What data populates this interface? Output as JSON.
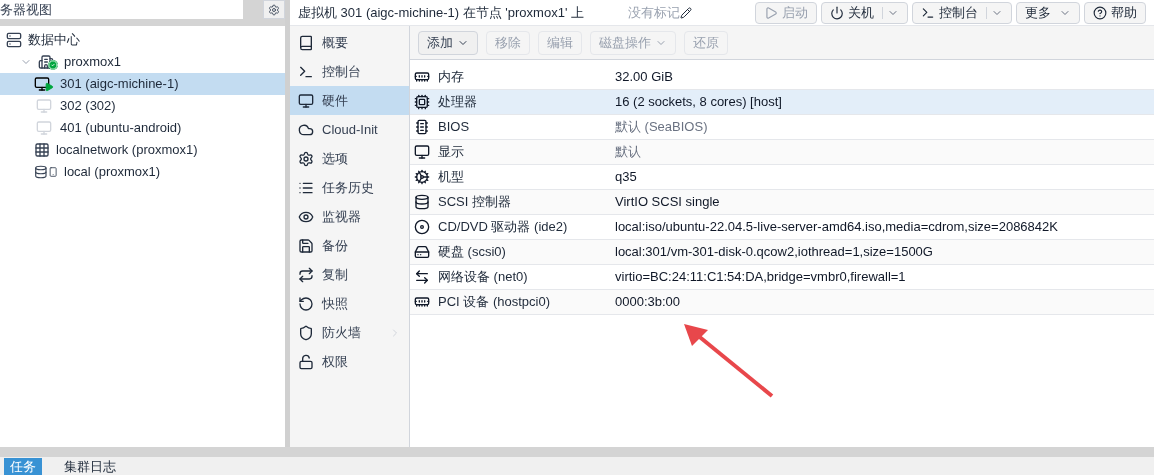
{
  "left_panel": {
    "view_field": {
      "value": "务器视图"
    },
    "tree": [
      {
        "label": "数据中心",
        "kind": "datacenter",
        "selected": false,
        "children": [
          {
            "label": "proxmox1",
            "kind": "node",
            "expanded": true,
            "selected": false,
            "children": [
              {
                "label": "301 (aigc-michine-1)",
                "kind": "vm",
                "running": true,
                "selected": true
              },
              {
                "label": "302 (302)",
                "kind": "vm",
                "running": false,
                "selected": false
              },
              {
                "label": "401 (ubuntu-android)",
                "kind": "vm",
                "running": false,
                "selected": false
              },
              {
                "label": "localnetwork (proxmox1)",
                "kind": "sdn",
                "selected": false
              },
              {
                "label": "local (proxmox1)",
                "kind": "storage",
                "selected": false
              }
            ]
          }
        ]
      }
    ]
  },
  "header": {
    "title": "虚拟机 301 (aigc-michine-1) 在节点 'proxmox1' 上",
    "tags": "没有标记",
    "buttons": [
      {
        "label": "启动",
        "kind": "start",
        "disabled": true,
        "split": false,
        "menu": false
      },
      {
        "label": "关机",
        "kind": "power",
        "disabled": false,
        "split": true,
        "menu": false
      },
      {
        "label": "控制台",
        "kind": "console",
        "disabled": false,
        "split": true,
        "menu": false
      },
      {
        "label": "更多",
        "kind": "plain",
        "disabled": false,
        "split": false,
        "menu": true
      },
      {
        "label": "帮助",
        "kind": "help",
        "disabled": false,
        "split": false,
        "menu": false
      }
    ]
  },
  "nav": [
    {
      "label": "概要",
      "selected": false
    },
    {
      "label": "控制台",
      "selected": false
    },
    {
      "label": "硬件",
      "selected": true
    },
    {
      "label": "Cloud-Init",
      "selected": false
    },
    {
      "label": "选项",
      "selected": false
    },
    {
      "label": "任务历史",
      "selected": false
    },
    {
      "label": "监视器",
      "selected": false
    },
    {
      "label": "备份",
      "selected": false
    },
    {
      "label": "复制",
      "selected": false
    },
    {
      "label": "快照",
      "selected": false
    },
    {
      "label": "防火墙",
      "selected": false,
      "has_submenu": true
    },
    {
      "label": "权限",
      "selected": false
    }
  ],
  "toolbar": [
    {
      "label": "添加",
      "disabled": false,
      "menu": true
    },
    {
      "label": "移除",
      "disabled": true,
      "menu": false
    },
    {
      "label": "编辑",
      "disabled": true,
      "menu": false
    },
    {
      "label": "磁盘操作",
      "disabled": true,
      "menu": true
    },
    {
      "label": "还原",
      "disabled": true,
      "menu": false
    }
  ],
  "hardware": [
    {
      "name": "内存",
      "value": "32.00 GiB",
      "muted": false,
      "selected": false
    },
    {
      "name": "处理器",
      "value": "16 (2 sockets, 8 cores) [host]",
      "muted": false,
      "selected": true
    },
    {
      "name": "BIOS",
      "value": "默认 (SeaBIOS)",
      "muted": true,
      "selected": false
    },
    {
      "name": "显示",
      "value": "默认",
      "muted": true,
      "selected": false
    },
    {
      "name": "机型",
      "value": "q35",
      "muted": false,
      "selected": false
    },
    {
      "name": "SCSI 控制器",
      "value": "VirtIO SCSI single",
      "muted": false,
      "selected": false
    },
    {
      "name": "CD/DVD 驱动器 (ide2)",
      "value": "local:iso/ubuntu-22.04.5-live-server-amd64.iso,media=cdrom,size=2086842K",
      "muted": false,
      "selected": false
    },
    {
      "name": "硬盘 (scsi0)",
      "value": "local:301/vm-301-disk-0.qcow2,iothread=1,size=1500G",
      "muted": false,
      "selected": false
    },
    {
      "name": "网络设备 (net0)",
      "value": "virtio=BC:24:11:C1:54:DA,bridge=vmbr0,firewall=1",
      "muted": false,
      "selected": false
    },
    {
      "name": "PCI 设备 (hostpci0)",
      "value": "0000:3b:00",
      "muted": false,
      "selected": false
    }
  ],
  "bottom_tabs": [
    {
      "label": "任务",
      "selected": true
    },
    {
      "label": "集群日志",
      "selected": false
    }
  ]
}
